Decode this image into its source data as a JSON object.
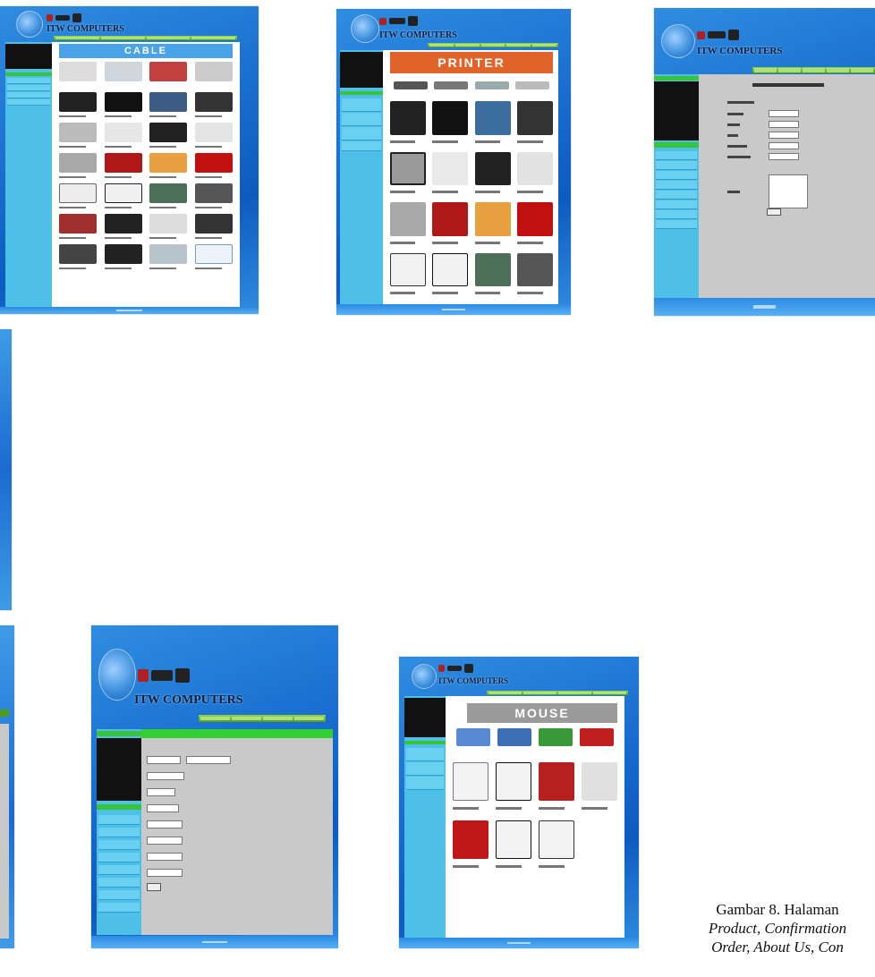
{
  "figure": {
    "brand_text": "ITW COMPUTERS",
    "banners": {
      "product": "CABLE",
      "printer": "PRINTER",
      "mouse": "MOUSE"
    },
    "caption": {
      "line1": "Gambar 8. Halaman",
      "line2": "Product, Confirmation",
      "line3": "Order, About Us, Con"
    }
  },
  "colors": {
    "page_bg": "#1a6fd0",
    "nav_green": "#4d9f1a",
    "sidebar_blue": "#4ec0e8",
    "printer_banner": "#e0642a",
    "cable_banner": "#4aa3e6",
    "mouse_banner": "#9a9a9a"
  }
}
